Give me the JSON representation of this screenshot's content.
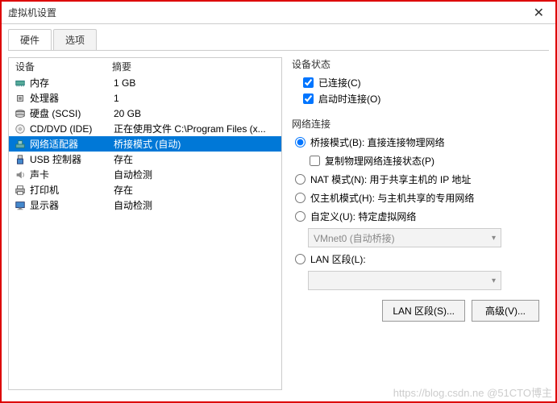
{
  "window": {
    "title": "虚拟机设置",
    "close": "✕"
  },
  "tabs": {
    "hardware": "硬件",
    "options": "选项"
  },
  "list_header": {
    "device": "设备",
    "summary": "摘要"
  },
  "devices": [
    {
      "name": "内存",
      "summary": "1 GB",
      "icon": "memory"
    },
    {
      "name": "处理器",
      "summary": "1",
      "icon": "cpu"
    },
    {
      "name": "硬盘 (SCSI)",
      "summary": "20 GB",
      "icon": "disk"
    },
    {
      "name": "CD/DVD (IDE)",
      "summary": "正在使用文件 C:\\Program Files (x...",
      "icon": "cd"
    },
    {
      "name": "网络适配器",
      "summary": "桥接模式 (自动)",
      "icon": "net"
    },
    {
      "name": "USB 控制器",
      "summary": "存在",
      "icon": "usb"
    },
    {
      "name": "声卡",
      "summary": "自动检测",
      "icon": "sound"
    },
    {
      "name": "打印机",
      "summary": "存在",
      "icon": "printer"
    },
    {
      "name": "显示器",
      "summary": "自动检测",
      "icon": "display"
    }
  ],
  "device_status": {
    "title": "设备状态",
    "connected": "已连接(C)",
    "connect_on_start": "启动时连接(O)"
  },
  "network": {
    "title": "网络连接",
    "bridged": "桥接模式(B): 直接连接物理网络",
    "replicate": "复制物理网络连接状态(P)",
    "nat": "NAT 模式(N): 用于共享主机的 IP 地址",
    "hostonly": "仅主机模式(H): 与主机共享的专用网络",
    "custom": "自定义(U): 特定虚拟网络",
    "custom_value": "VMnet0 (自动桥接)",
    "lan": "LAN 区段(L):",
    "lan_button": "LAN 区段(S)...",
    "advanced": "高级(V)..."
  },
  "watermark": "https://blog.csdn.ne @51CTO博主"
}
